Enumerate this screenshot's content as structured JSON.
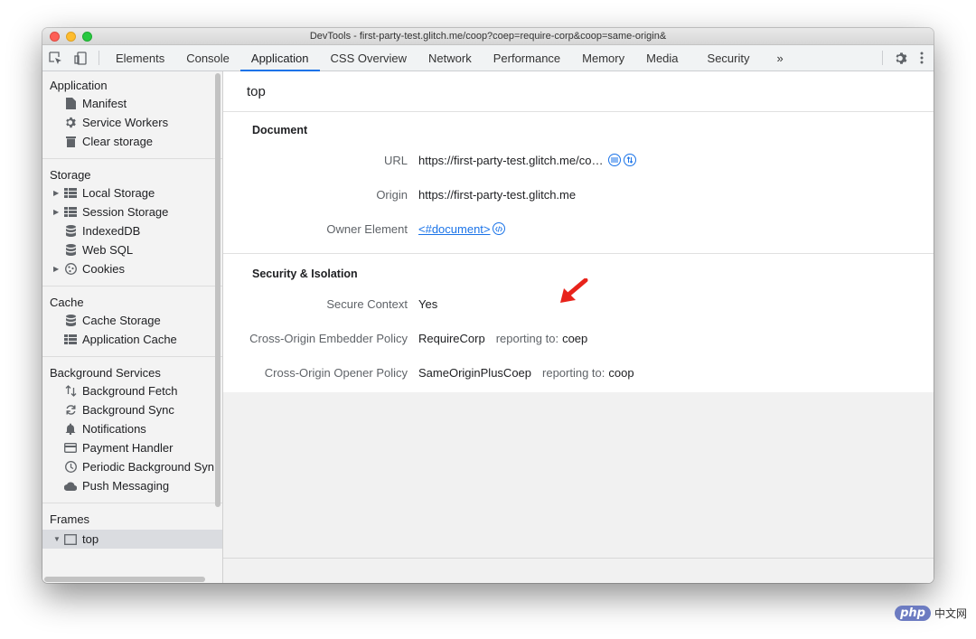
{
  "window": {
    "title": "DevTools - first-party-test.glitch.me/coop?coep=require-corp&coop=same-origin&"
  },
  "tabs": [
    {
      "label": "Elements"
    },
    {
      "label": "Console"
    },
    {
      "label": "Application",
      "active": true
    },
    {
      "label": "CSS Overview"
    },
    {
      "label": "Network"
    },
    {
      "label": "Performance"
    },
    {
      "label": "Memory"
    },
    {
      "label": "Media"
    },
    {
      "label": "Security"
    }
  ],
  "tabs_more": "»",
  "sidebar": {
    "application": {
      "title": "Application",
      "items": [
        {
          "label": "Manifest",
          "icon": "document-icon"
        },
        {
          "label": "Service Workers",
          "icon": "gear-icon"
        },
        {
          "label": "Clear storage",
          "icon": "trash-icon"
        }
      ]
    },
    "storage": {
      "title": "Storage",
      "items": [
        {
          "label": "Local Storage",
          "icon": "grid-icon"
        },
        {
          "label": "Session Storage",
          "icon": "grid-icon"
        },
        {
          "label": "IndexedDB",
          "icon": "database-icon"
        },
        {
          "label": "Web SQL",
          "icon": "database-icon"
        },
        {
          "label": "Cookies",
          "icon": "cookie-icon"
        }
      ]
    },
    "cache": {
      "title": "Cache",
      "items": [
        {
          "label": "Cache Storage",
          "icon": "database-icon"
        },
        {
          "label": "Application Cache",
          "icon": "grid-icon"
        }
      ]
    },
    "background": {
      "title": "Background Services",
      "items": [
        {
          "label": "Background Fetch",
          "icon": "updown-arrows-icon"
        },
        {
          "label": "Background Sync",
          "icon": "sync-icon"
        },
        {
          "label": "Notifications",
          "icon": "bell-icon"
        },
        {
          "label": "Payment Handler",
          "icon": "card-icon"
        },
        {
          "label": "Periodic Background Syn",
          "icon": "clock-icon"
        },
        {
          "label": "Push Messaging",
          "icon": "cloud-icon"
        }
      ]
    },
    "frames": {
      "title": "Frames",
      "items": [
        {
          "label": "top",
          "icon": "frame-icon"
        }
      ]
    }
  },
  "main": {
    "header": "top",
    "document": {
      "title": "Document",
      "url_label": "URL",
      "url_value": "https://first-party-test.glitch.me/co…",
      "origin_label": "Origin",
      "origin_value": "https://first-party-test.glitch.me",
      "owner_label": "Owner Element",
      "owner_value": "<#document>"
    },
    "security": {
      "title": "Security & Isolation",
      "secure_label": "Secure Context",
      "secure_value": "Yes",
      "coep_label": "Cross-Origin Embedder Policy",
      "coep_value": "RequireCorp",
      "coep_reporting_label": "reporting to:",
      "coep_reporting_value": "coep",
      "coop_label": "Cross-Origin Opener Policy",
      "coop_value": "SameOriginPlusCoep",
      "coop_reporting_label": "reporting to:",
      "coop_reporting_value": "coop"
    }
  },
  "watermark": {
    "badge": "php",
    "text": "中文网"
  },
  "colors": {
    "accent": "#1a73e8",
    "annotation": "#e8231b"
  }
}
